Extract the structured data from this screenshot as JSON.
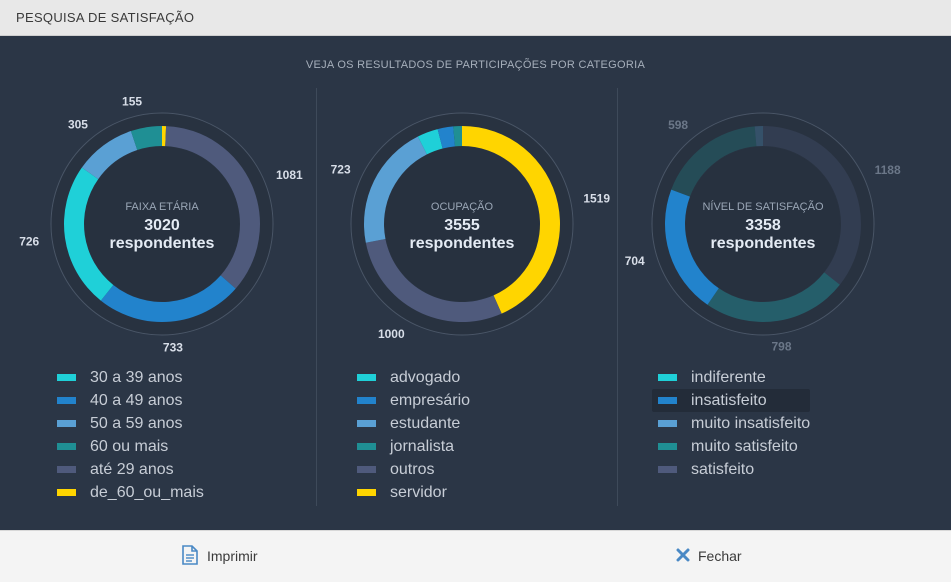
{
  "window": {
    "title": "PESQUISA DE SATISFAÇÃO"
  },
  "main": {
    "subtitle": "VEJA OS RESULTADOS DE PARTICIPAÇÕES POR CATEGORIA"
  },
  "footer": {
    "print_label": "Imprimir",
    "print_icon": "document-icon",
    "close_label": "Fechar",
    "close_icon": "close-x-icon",
    "icon_color": "#4a89c5"
  },
  "colors": {
    "background": "#2b3646",
    "center_label": "#9aa6b6",
    "center_value": "#e4ebf4",
    "value_label": "#d8dee8",
    "value_label_dim": "#6b7788",
    "highlight": "#232c39"
  },
  "chart_data": [
    {
      "type": "pie",
      "variant": "donut",
      "center_label": "FAIXA ETÁRIA",
      "center_total": "3020",
      "center_unit": "respondentes",
      "slices": [
        {
          "label": "30 a 39 anos",
          "value": 726,
          "color": "#1fd0d8"
        },
        {
          "label": "40 a 49 anos",
          "value": 733,
          "color": "#2283cc"
        },
        {
          "label": "50 a 59 anos",
          "value": 305,
          "color": "#5aa0d4"
        },
        {
          "label": "60 ou mais",
          "value": 155,
          "color": "#1f8f94"
        },
        {
          "label": "até 29 anos",
          "value": 1081,
          "color": "#4f5a7c"
        },
        {
          "label": "de_60_ou_mais",
          "value": 20,
          "color": "#ffd500"
        }
      ],
      "order": [
        5,
        4,
        1,
        0,
        2,
        3
      ],
      "shown_values": [
        "1081",
        "733",
        "726",
        "305",
        "155"
      ],
      "dimmed": []
    },
    {
      "type": "pie",
      "variant": "donut",
      "center_label": "OCUPAÇÃO",
      "center_total": "3555",
      "center_unit": "respondentes",
      "slices": [
        {
          "label": "advogado",
          "value": 120,
          "color": "#1fd0d8"
        },
        {
          "label": "empresário",
          "value": 90,
          "color": "#2283cc"
        },
        {
          "label": "estudante",
          "value": 723,
          "color": "#5aa0d4"
        },
        {
          "label": "jornalista",
          "value": 50,
          "color": "#1f8f94"
        },
        {
          "label": "outros",
          "value": 1000,
          "color": "#4f5a7c"
        },
        {
          "label": "servidor",
          "value": 1519,
          "color": "#ffd500"
        }
      ],
      "order": [
        5,
        4,
        2,
        0,
        1,
        3
      ],
      "shown_values": [
        "1519",
        "1000",
        "723"
      ],
      "dimmed": []
    },
    {
      "type": "pie",
      "variant": "donut",
      "center_label": "NÍVEL DE SATISFAÇÃO",
      "center_total": "3358",
      "center_unit": "respondentes",
      "slices": [
        {
          "label": "indiferente",
          "value": 798,
          "color": "#1fd0d8"
        },
        {
          "label": "insatisfeito",
          "value": 704,
          "color": "#2283cc"
        },
        {
          "label": "muito insatisfeito",
          "value": 45,
          "color": "#5aa0d4"
        },
        {
          "label": "muito satisfeito",
          "value": 598,
          "color": "#1f8f94"
        },
        {
          "label": "satisfeito",
          "value": 1188,
          "color": "#4f5a7c"
        }
      ],
      "order": [
        4,
        0,
        1,
        3,
        2
      ],
      "shown_values": [
        "1188",
        "798",
        "704",
        "598"
      ],
      "dimmed": [
        4,
        0,
        3,
        2
      ],
      "highlighted": 1
    }
  ]
}
